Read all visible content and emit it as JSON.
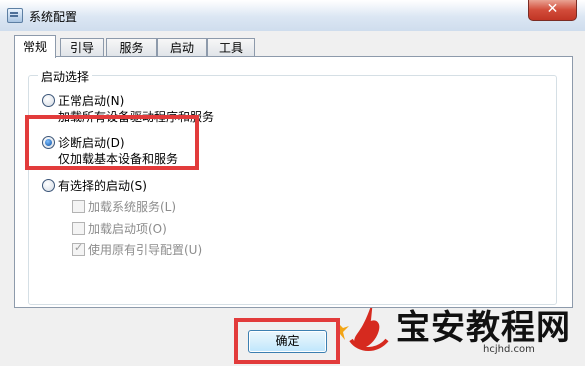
{
  "window": {
    "title": "系统配置",
    "close_glyph": "✕"
  },
  "tabs": [
    {
      "label": "常规",
      "active": true
    },
    {
      "label": "引导",
      "active": false
    },
    {
      "label": "服务",
      "active": false
    },
    {
      "label": "启动",
      "active": false
    },
    {
      "label": "工具",
      "active": false
    }
  ],
  "startup_selection": {
    "legend": "启动选择",
    "options": [
      {
        "label": "正常启动(N)",
        "description": "加载所有设备驱动程序和服务",
        "selected": false
      },
      {
        "label": "诊断启动(D)",
        "description": "仅加载基本设备和服务",
        "selected": true
      },
      {
        "label": "有选择的启动(S)",
        "selected": false
      }
    ],
    "selective_items": [
      {
        "label": "加载系统服务(L)",
        "checked": false
      },
      {
        "label": "加载启动项(O)",
        "checked": false
      },
      {
        "label": "使用原有引导配置(U)",
        "checked": true
      }
    ]
  },
  "buttons": {
    "ok": "确定"
  },
  "highlight_color": "#e23b3b",
  "watermark": {
    "title": "宝安教程网",
    "domain": "hcjhd.com"
  }
}
